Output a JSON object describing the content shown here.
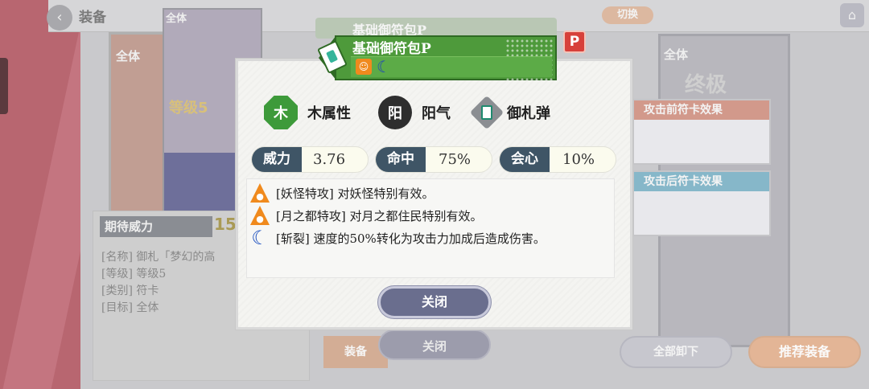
{
  "topbar": {
    "title": "装备",
    "switch_label": "切换"
  },
  "left_card": {
    "tag": "全体"
  },
  "top_card": {
    "tag": "全体",
    "level": "等级5"
  },
  "info_panel": {
    "expect_label": "期待威力",
    "expect_value": "15",
    "lines": [
      "[名称] 御札「梦幻的高",
      "[等级] 等级5",
      "[类别] 符卡",
      "[目标] 全体"
    ]
  },
  "bottom_left": {
    "equip_label": "装备",
    "close_label": "关闭"
  },
  "right_panel": {
    "tag": "全体",
    "big_text": "终极",
    "effect_before_header": "攻击前符卡效果",
    "effect_after_header": "攻击后符卡效果",
    "unequip_all_label": "全部卸下",
    "recommend_label": "推荐装备"
  },
  "modal": {
    "banner_back_title": "基础御符包P",
    "banner_title": "基础御符包P",
    "p_badge": "P",
    "attributes": [
      {
        "icon": "wood-element-icon",
        "glyph": "木",
        "label": "木属性"
      },
      {
        "icon": "yang-icon",
        "glyph": "阳",
        "label": "阳气"
      },
      {
        "icon": "talisman-bullet-icon",
        "glyph": "",
        "label": "御札弹"
      }
    ],
    "stats": [
      {
        "label": "威力",
        "value": "3.76"
      },
      {
        "label": "命中",
        "value": "75%"
      },
      {
        "label": "会心",
        "value": "10%"
      }
    ],
    "effects": [
      {
        "icon": "youkai-slayer-icon",
        "text": "[妖怪特攻] 对妖怪特别有效。"
      },
      {
        "icon": "lunarian-slayer-icon",
        "text": "[月之都特攻] 对月之都住民特别有效。"
      },
      {
        "icon": "moon-slash-icon",
        "text": "[斩裂] 速度的50%转化为攻击力加成后造成伤害。"
      }
    ],
    "close_label": "关闭"
  },
  "colors": {
    "banner_green": "#4e9a3b",
    "stat_label_bg": "#3f5566",
    "close_button": "#6a6e8e",
    "effect_before": "#d2998b",
    "effect_after": "#86b7c9"
  }
}
